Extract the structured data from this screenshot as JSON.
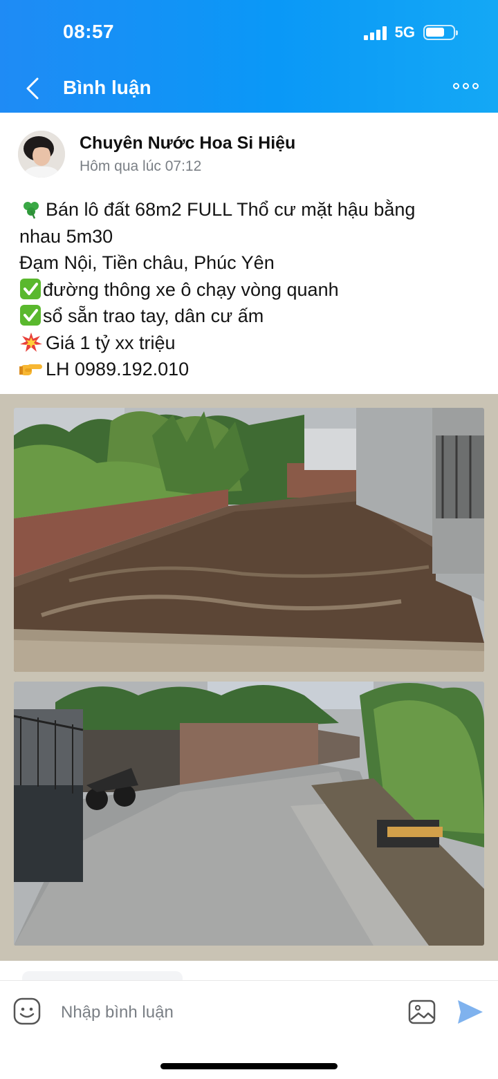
{
  "status_bar": {
    "time": "08:57",
    "network": "5G"
  },
  "header": {
    "title": "Bình luận"
  },
  "post": {
    "author": "Chuyên Nước Hoa Si Hiệu",
    "time": "Hôm qua lúc 07:12",
    "lines": [
      "Bán lô đất 68m2 FULL Thổ cư mặt hậu bằng",
      "nhau 5m30",
      "Đạm Nội, Tiền châu, Phúc Yên",
      "đường thông xe ô chạy vòng quanh",
      "sổ sẵn trao tay, dân cư ấm",
      "Giá 1 tỷ xx triệu",
      "LH 0989.192.010"
    ]
  },
  "composer": {
    "placeholder": "Nhập bình luận"
  },
  "colors": {
    "header_gradient_start": "#1f8bf5",
    "header_gradient_end": "#14a8f5",
    "send": "#7fb2ee"
  }
}
